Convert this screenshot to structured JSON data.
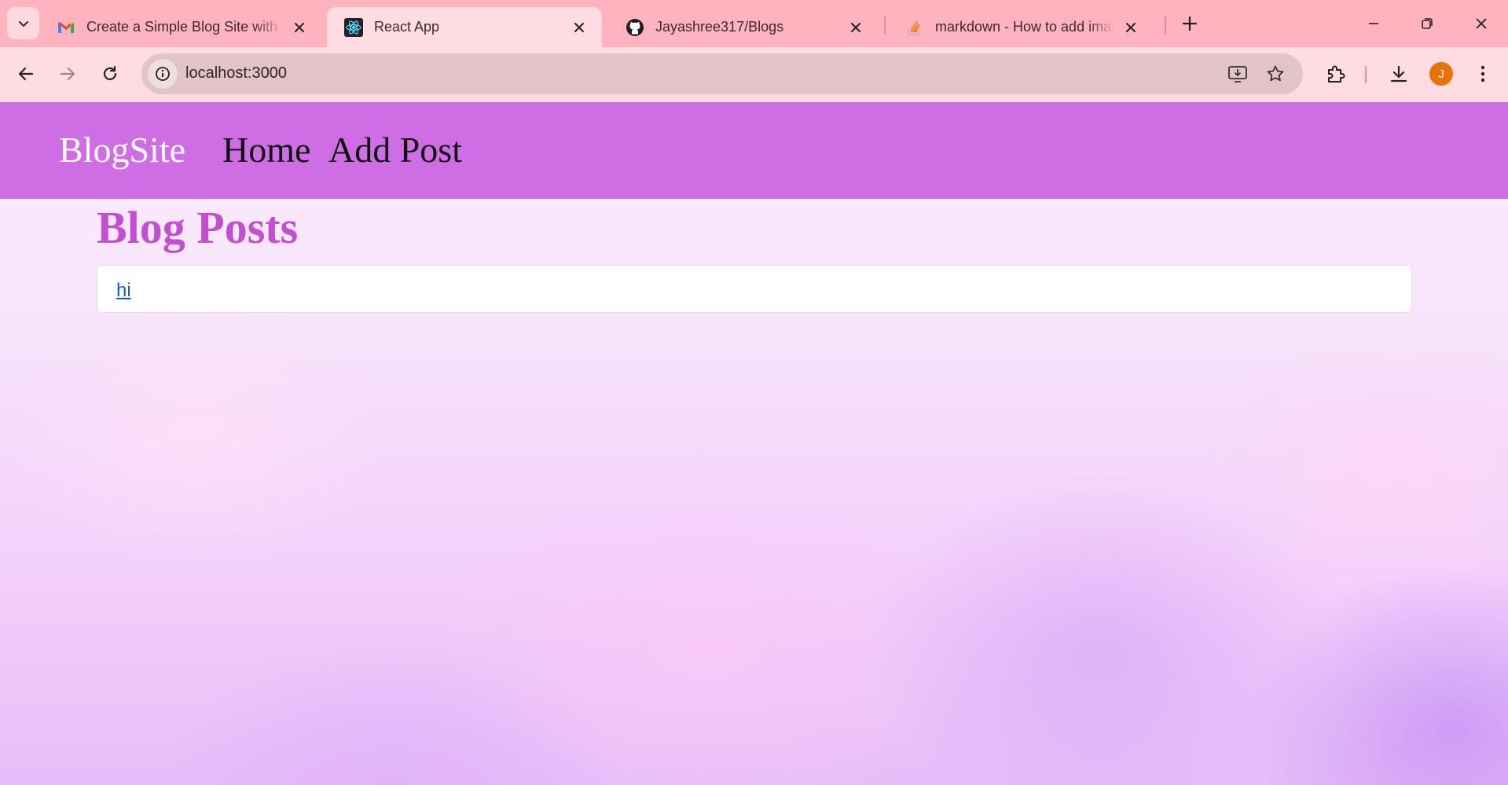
{
  "browser": {
    "tabs": [
      {
        "title": "Create a Simple Blog Site with R",
        "favicon": "gmail-icon",
        "active": false
      },
      {
        "title": "React App",
        "favicon": "react-icon",
        "active": true
      },
      {
        "title": "Jayashree317/Blogs",
        "favicon": "github-icon",
        "active": false
      },
      {
        "title": "markdown - How to add image",
        "favicon": "stackoverflow-icon",
        "active": false
      }
    ],
    "address": "localhost:3000",
    "profile_initial": "J"
  },
  "site": {
    "brand": "BlogSite",
    "nav": {
      "home": "Home",
      "add_post": "Add Post"
    },
    "heading": "Blog Posts",
    "posts": [
      {
        "title": "hi"
      }
    ]
  },
  "colors": {
    "navbar": "#cf6ee4",
    "heading": "#c24fd0",
    "link": "#1a56db",
    "tabstrip": "#ffb3bf",
    "toolbar": "#ffdce2"
  }
}
